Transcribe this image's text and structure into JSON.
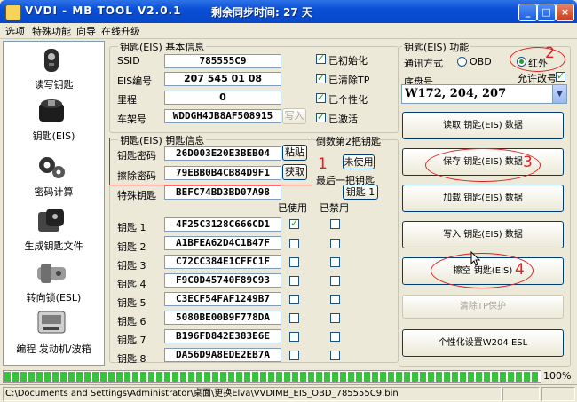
{
  "window": {
    "title": "VVDI - MB TOOL V2.0.1",
    "remaining_time": "剩余同步时间: 27 天",
    "minimize": "_",
    "maximize": "□",
    "close": "×"
  },
  "menu": [
    "选项",
    "特殊功能",
    "向导",
    "在线升级"
  ],
  "sidebar": [
    {
      "label": "读写钥匙",
      "icon": "car-key-icon"
    },
    {
      "label": "钥匙(EIS)",
      "icon": "ignition-switch-icon"
    },
    {
      "label": "密码计算",
      "icon": "gears-icon"
    },
    {
      "label": "生成钥匙文件",
      "icon": "key-file-icon"
    },
    {
      "label": "转向锁(ESL)",
      "icon": "steering-lock-icon"
    },
    {
      "label": "编程 发动机/波箱",
      "icon": "ecu-module-icon"
    }
  ],
  "eis_info": {
    "title": "钥匙(EIS) 基本信息",
    "ssid_label": "SSID",
    "ssid": "785555C9",
    "eis_no_label": "EIS编号",
    "eis_no": "207 545 01 08",
    "mileage_label": "里程",
    "mileage": "0",
    "vin_label": "车架号",
    "vin": "WDDGH4JB8AF508915",
    "write_btn": "写入",
    "checks": [
      {
        "label": "已初始化",
        "checked": true
      },
      {
        "label": "已清除TP",
        "checked": true
      },
      {
        "label": "已个性化",
        "checked": true
      },
      {
        "label": "已激活",
        "checked": true
      }
    ]
  },
  "eis_keys": {
    "title": "钥匙(EIS) 钥匙信息",
    "key_password_label": "钥匙密码",
    "key_password": "26D003E20E3BEB04",
    "paste_btn": "粘贴",
    "erase_password_label": "擦除密码",
    "erase_password": "79EBB0B4CB84D9F1",
    "get_btn": "获取",
    "special_key_label": "特殊钥匙",
    "special_key": "BEFC74BD3BD07A98",
    "used_header": "已使用",
    "disabled_header": "已禁用",
    "second_last_label": "倒数第2把钥匙",
    "unused_btn": "未使用",
    "last_label": "最后一把钥匙",
    "key1_btn": "钥匙 1",
    "keys": [
      {
        "label": "钥匙 1",
        "value": "4F25C3128C666CD1",
        "used": true,
        "disabled": false
      },
      {
        "label": "钥匙 2",
        "value": "A1BFEA62D4C1B47F",
        "used": false,
        "disabled": false
      },
      {
        "label": "钥匙 3",
        "value": "C72CC384E1CFFC1F",
        "used": false,
        "disabled": false
      },
      {
        "label": "钥匙 4",
        "value": "F9C0D45740F89C93",
        "used": false,
        "disabled": false
      },
      {
        "label": "钥匙 5",
        "value": "C3ECF54FAF1249B7",
        "used": false,
        "disabled": false
      },
      {
        "label": "钥匙 6",
        "value": "5080BE00B9F778DA",
        "used": false,
        "disabled": false
      },
      {
        "label": "钥匙 7",
        "value": "B196FD842E383E6E",
        "used": false,
        "disabled": false
      },
      {
        "label": "钥匙 8",
        "value": "DA56D9A8EDE2EB7A",
        "used": false,
        "disabled": false
      }
    ]
  },
  "eis_func": {
    "title": "钥匙(EIS) 功能",
    "comm_label": "通讯方式",
    "obd": "OBD",
    "ir": "红外",
    "chassis_label": "底盘号",
    "allow_vin_label": "允许改号",
    "chassis_value": "W172, 204, 207",
    "buttons": [
      {
        "label": "读取 钥匙(EIS) 数据",
        "enabled": true
      },
      {
        "label": "保存 钥匙(EIS) 数据",
        "enabled": true
      },
      {
        "label": "加载 钥匙(EIS) 数据",
        "enabled": true
      },
      {
        "label": "写入 钥匙(EIS) 数据",
        "enabled": true
      },
      {
        "label": "擦空 钥匙(EIS)",
        "enabled": true
      },
      {
        "label": "清除TP保护",
        "enabled": false
      },
      {
        "label": "个性化设置W204 ESL",
        "enabled": true
      }
    ]
  },
  "annotations": [
    "1",
    "2",
    "3",
    "4"
  ],
  "progress": {
    "value": 100,
    "text": "100%"
  },
  "status": {
    "path": "C:\\Documents and Settings\\Administrator\\桌面\\更换Elva\\VVDIMB_EIS_OBD_785555C9.bin"
  },
  "colors": {
    "annotation": "#e02020",
    "titlebar": "#0a4fd6",
    "progress": "#37c33a"
  }
}
